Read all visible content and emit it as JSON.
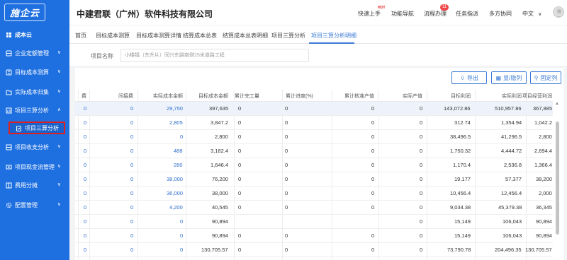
{
  "app": {
    "logo": "施企云"
  },
  "sidebar": {
    "items": [
      {
        "label": "成本云",
        "icon": "home-icon",
        "chev": ""
      },
      {
        "label": "企业定额管理",
        "icon": "database-icon",
        "chev": "∨"
      },
      {
        "label": "目标成本测算",
        "icon": "calculator-icon",
        "chev": "∨"
      },
      {
        "label": "实际成本归集",
        "icon": "folder-icon",
        "chev": "∨"
      },
      {
        "label": "项目三算分析",
        "icon": "chart-icon",
        "chev": "∧"
      },
      {
        "label": "项目收支分析",
        "icon": "balance-icon",
        "chev": "∨"
      },
      {
        "label": "项目现金流管理",
        "icon": "cash-icon",
        "chev": "∨"
      },
      {
        "label": "费用分摊",
        "icon": "share-icon",
        "chev": "∨"
      },
      {
        "label": "配置管理",
        "icon": "gear-icon",
        "chev": "∨"
      }
    ],
    "active_sub": "项目三算分析"
  },
  "header": {
    "company": "中建君联（广州）软件科技有限公司",
    "links": [
      "快速上手",
      "功能导航",
      "流程办理",
      "任务指派",
      "多方协同"
    ],
    "hot": "HOT",
    "badge": "11",
    "language": "中文",
    "language_chev": "∨"
  },
  "tabs": [
    "首页",
    "目标成本测算",
    "目标成本测算详情",
    "结算成本总表",
    "结算成本总表明细",
    "项目三算分析",
    "项目三算分析明细"
  ],
  "filter": {
    "label": "项目名称",
    "value": "小楼镇（东升片）同兴东路南侧15米道路工程"
  },
  "toolbar": {
    "export": "导出",
    "show_columns": "显/隐列",
    "pin_columns": "固定列"
  },
  "table": {
    "columns": [
      "费",
      "间接费",
      "实际成本金额",
      "目标成本金额",
      "累计完工量",
      "累计进度(%)",
      "累计核准产值",
      "实际产值",
      "目标利润",
      "实际利润",
      "项目经营利润"
    ],
    "rows": [
      [
        "0",
        "0",
        "29,750",
        "397,635",
        "0",
        "0",
        "0",
        "0",
        "143,072.86",
        "510,957.86",
        "367,885"
      ],
      [
        "0",
        "0",
        "2,805",
        "3,847.2",
        "0",
        "0",
        "0",
        "0",
        "312.74",
        "1,354.94",
        "1,042.2"
      ],
      [
        "0",
        "0",
        "0",
        "2,800",
        "0",
        "0",
        "0",
        "0",
        "38,496.5",
        "41,296.5",
        "2,800"
      ],
      [
        "0",
        "0",
        "488",
        "3,182.4",
        "0",
        "0",
        "0",
        "0",
        "1,750.32",
        "4,444.72",
        "2,694.4"
      ],
      [
        "0",
        "0",
        "280",
        "1,646.4",
        "0",
        "0",
        "0",
        "0",
        "1,170.4",
        "2,536.8",
        "1,366.4"
      ],
      [
        "0",
        "0",
        "38,000",
        "76,200",
        "0",
        "0",
        "0",
        "0",
        "19,177",
        "57,377",
        "38,200"
      ],
      [
        "0",
        "0",
        "36,000",
        "38,000",
        "0",
        "0",
        "0",
        "0",
        "10,456.4",
        "12,456.4",
        "2,000"
      ],
      [
        "0",
        "0",
        "4,200",
        "40,545",
        "0",
        "0",
        "0",
        "0",
        "9,034.38",
        "45,379.38",
        "36,345"
      ],
      [
        "0",
        "0",
        "0",
        "90,894",
        "",
        "",
        "",
        "0",
        "15,149",
        "106,043",
        "90,894"
      ],
      [
        "0",
        "0",
        "0",
        "90,894",
        "0",
        "0",
        "0",
        "0",
        "15,149",
        "106,043",
        "90,894"
      ],
      [
        "0",
        "0",
        "0",
        "130,705.57",
        "0",
        "0",
        "0",
        "0",
        "73,790.78",
        "204,496.35",
        "130,705.57"
      ]
    ]
  },
  "colors": {
    "primary": "#1e6fe0",
    "link": "#2f6ecb",
    "highlight": "#e02020"
  }
}
